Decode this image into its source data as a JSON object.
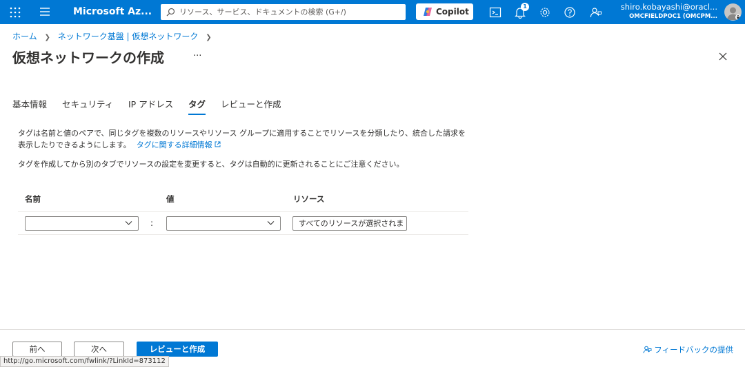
{
  "topbar": {
    "brand": "Microsoft Az...",
    "search_placeholder": "リソース、サービス、ドキュメントの検索 (G+/)",
    "copilot_label": "Copilot",
    "notification_count": "1",
    "user_name": "shiro.kobayashi@oracl...",
    "user_directory": "OMCFIELDPOC1 (OMCPM..."
  },
  "breadcrumb": {
    "items": [
      "ホーム",
      "ネットワーク基盤 | 仮想ネットワーク"
    ]
  },
  "page": {
    "title": "仮想ネットワークの作成",
    "more": "···"
  },
  "tabs": [
    {
      "label": "基本情報",
      "active": false
    },
    {
      "label": "セキュリティ",
      "active": false
    },
    {
      "label": "IP アドレス",
      "active": false
    },
    {
      "label": "タグ",
      "active": true
    },
    {
      "label": "レビューと作成",
      "active": false
    }
  ],
  "content": {
    "description": "タグは名前と値のペアで、同じタグを複数のリソースやリソース グループに適用することでリソースを分類したり、統合した請求を表示したりできるようにします。",
    "learn_more_link": "タグに関する詳細情報",
    "note": "タグを作成してから別のタブでリソースの設定を変更すると、タグは自動的に更新されることにご注意ください。"
  },
  "tag_table": {
    "headers": {
      "name": "名前",
      "value": "値",
      "resource": "リソース"
    },
    "rows": [
      {
        "name": "",
        "separator": ":",
        "value": "",
        "resource": "すべてのリソースが選択されま"
      }
    ]
  },
  "footer": {
    "prev_label": "前へ",
    "next_label": "次へ",
    "review_label": "レビューと作成",
    "feedback_label": "フィードバックの提供"
  },
  "status_bar": {
    "url": "http://go.microsoft.com/fwlink/?LinkId=873112"
  },
  "colors": {
    "accent": "#0078d4",
    "text": "#323130"
  }
}
